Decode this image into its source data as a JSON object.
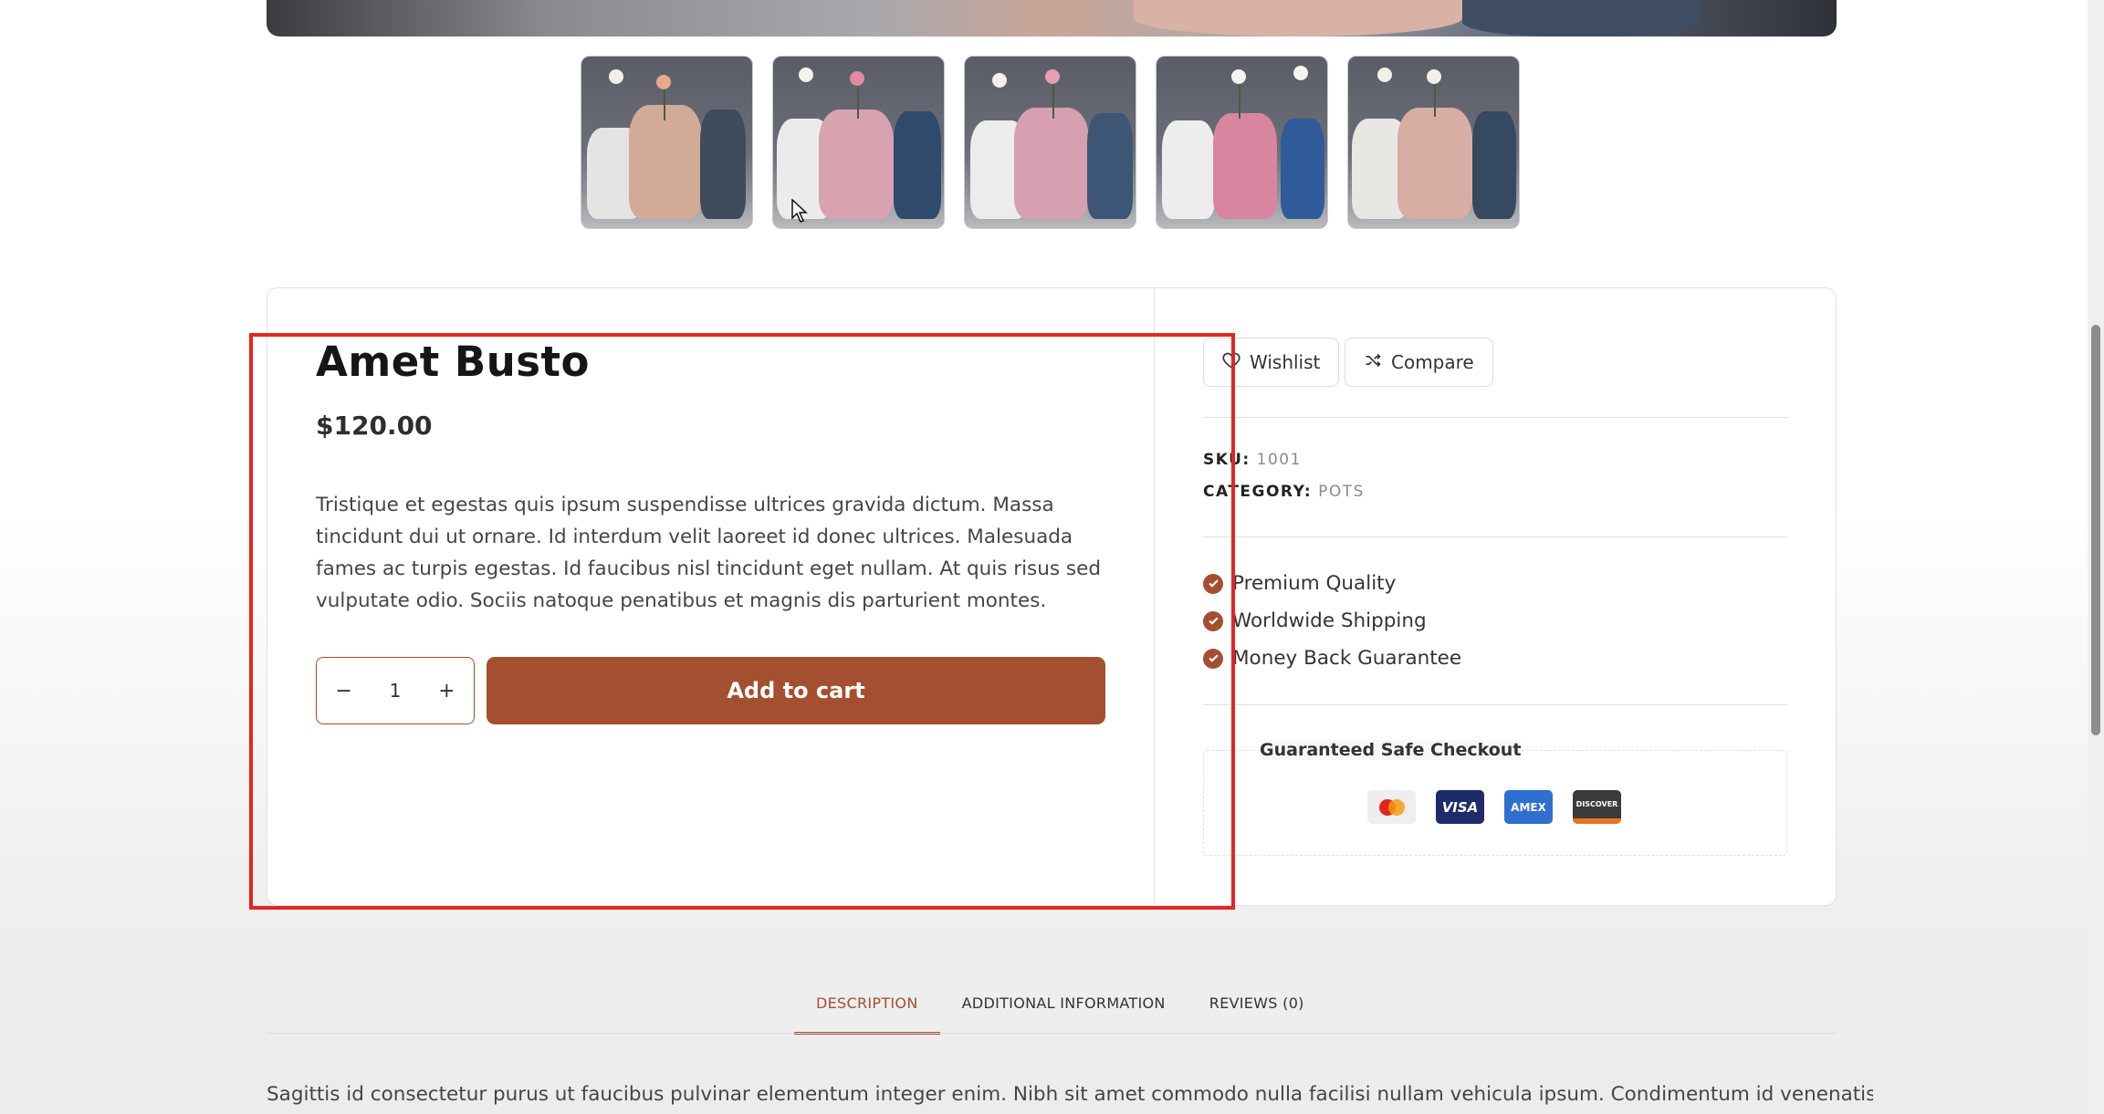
{
  "product": {
    "title": "Amet Busto",
    "price": "$120.00",
    "description": "Tristique et egestas quis ipsum suspendisse ultrices gravida dictum. Massa tincidunt dui ut ornare. Id interdum velit laoreet id donec ultrices. Malesuada fames ac turpis egestas. Id faucibus nisl tincidunt eget nullam. At quis risus sed vulputate odio. Sociis natoque penatibus et magnis dis parturient montes.",
    "quantity": "1",
    "decrement_label": "−",
    "increment_label": "+",
    "add_to_cart_label": "Add to cart"
  },
  "actions": {
    "wishlist_label": "Wishlist",
    "compare_label": "Compare"
  },
  "meta": {
    "sku_label": "SKU:",
    "sku_value": "1001",
    "category_label": "CATEGORY:",
    "category_value": "POTS"
  },
  "features": [
    "Premium Quality",
    "Worldwide Shipping",
    "Money Back Guarantee"
  ],
  "safe_checkout": {
    "title": "Guaranteed Safe Checkout",
    "payment_methods": [
      {
        "name": "mastercard",
        "label": "",
        "color": "#eeeeee"
      },
      {
        "name": "visa",
        "label": "VISA",
        "color": "#1f2a6b"
      },
      {
        "name": "amex",
        "label": "AMEX",
        "color": "#2e6fd0"
      },
      {
        "name": "discover",
        "label": "DISCOVER",
        "color": "#3b3b3b"
      }
    ]
  },
  "tabs": [
    {
      "label": "DESCRIPTION",
      "active": true
    },
    {
      "label": "ADDITIONAL INFORMATION",
      "active": false
    },
    {
      "label": "REVIEWS (0)",
      "active": false
    }
  ],
  "tab_content": "Sagittis id consectetur purus ut faucibus pulvinar elementum integer enim. Nibh sit amet commodo nulla facilisi nullam vehicula ipsum. Condimentum id venenatis a",
  "colors": {
    "accent": "#a44f30",
    "highlight": "#e52521"
  }
}
